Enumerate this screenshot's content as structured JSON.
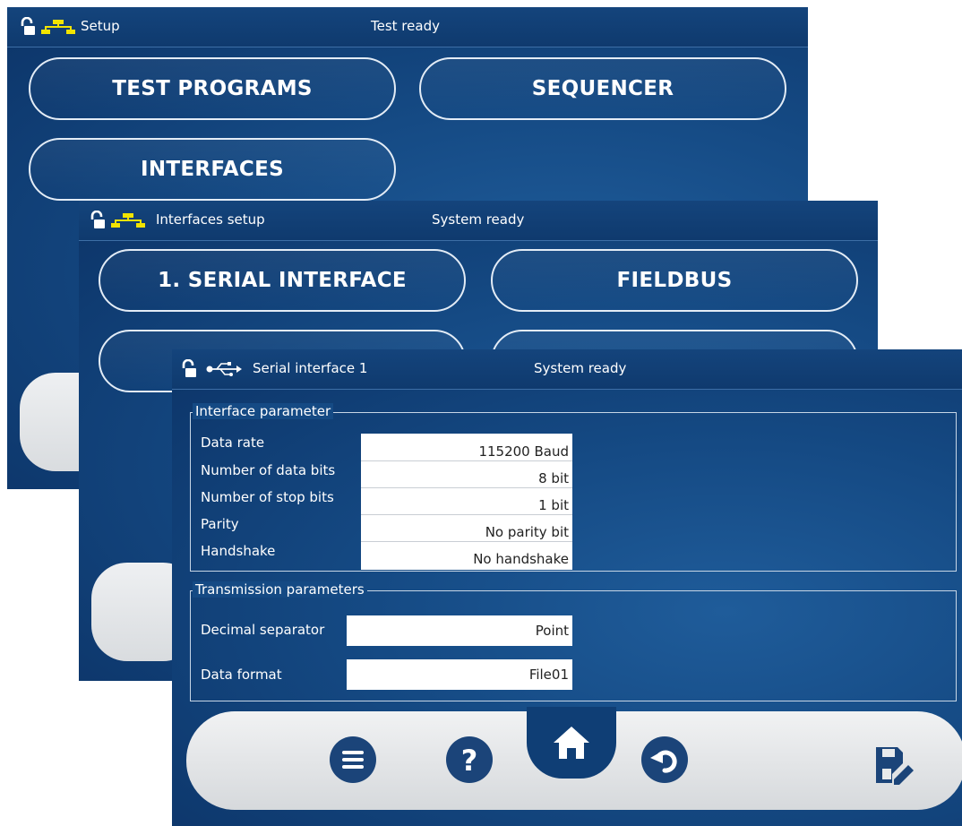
{
  "setup_panel": {
    "title": "Setup",
    "status": "Test ready",
    "buttons": [
      "TEST PROGRAMS",
      "SEQUENCER",
      "INTERFACES"
    ]
  },
  "interfaces_panel": {
    "title": "Interfaces setup",
    "status": "System ready",
    "buttons": [
      "1. SERIAL INTERFACE",
      "FIELDBUS"
    ]
  },
  "serial_panel": {
    "title": "Serial interface 1",
    "status": "System ready",
    "interface_group": {
      "title": "Interface parameter",
      "rows": [
        {
          "label": "Data rate",
          "value": "115200 Baud"
        },
        {
          "label": "Number of data bits",
          "value": "8 bit"
        },
        {
          "label": "Number of stop bits",
          "value": "1 bit"
        },
        {
          "label": "Parity",
          "value": "No parity bit"
        },
        {
          "label": "Handshake",
          "value": "No handshake"
        }
      ]
    },
    "transmission_group": {
      "title": "Transmission parameters",
      "rows": [
        {
          "label": "Decimal separator",
          "value": "Point"
        },
        {
          "label": "Data format",
          "value": "File01"
        }
      ]
    },
    "bottom_icons": [
      "menu-icon",
      "help-icon",
      "home-icon",
      "undo-icon",
      "save-edit-icon"
    ]
  },
  "colors": {
    "panel_blue": "#154a84",
    "network_icon": "#f2e400",
    "button_dark": "#1b4479"
  }
}
